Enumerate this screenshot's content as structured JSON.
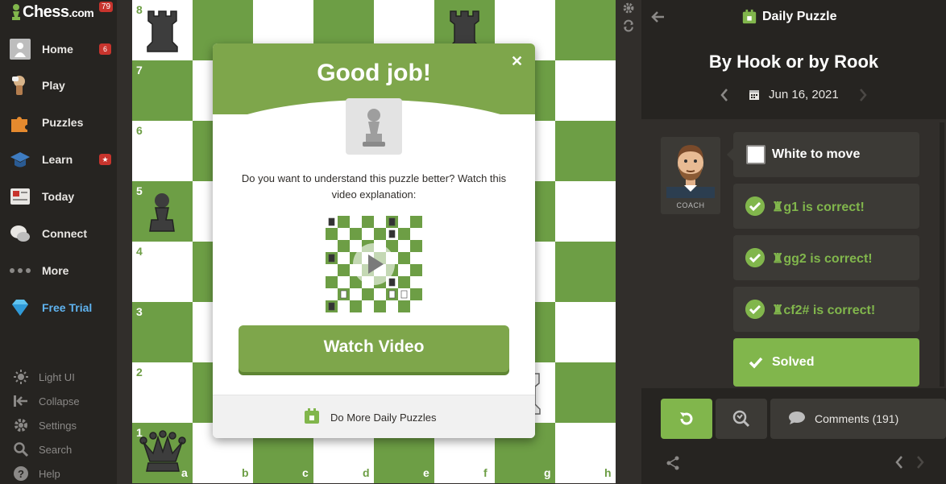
{
  "brand": {
    "logo_text": "Chess",
    "logo_suffix": ".com",
    "notif_count": "79"
  },
  "sidebar": {
    "items": [
      {
        "label": "Home",
        "badge": "6",
        "icon": "home-avatar-icon"
      },
      {
        "label": "Play",
        "badge": "",
        "icon": "play-hand-icon"
      },
      {
        "label": "Puzzles",
        "badge": "",
        "icon": "puzzle-piece-icon"
      },
      {
        "label": "Learn",
        "badge": "★",
        "icon": "graduation-cap-icon"
      },
      {
        "label": "Today",
        "badge": "",
        "icon": "newspaper-icon"
      },
      {
        "label": "Connect",
        "badge": "",
        "icon": "chat-bubbles-icon"
      },
      {
        "label": "More",
        "badge": "",
        "icon": "more-dots-icon"
      },
      {
        "label": "Free Trial",
        "badge": "",
        "icon": "diamond-icon"
      }
    ],
    "bottom": [
      {
        "label": "Light UI",
        "icon": "sun-icon"
      },
      {
        "label": "Collapse",
        "icon": "collapse-icon"
      },
      {
        "label": "Settings",
        "icon": "gear-icon"
      },
      {
        "label": "Search",
        "icon": "search-icon"
      },
      {
        "label": "Help",
        "icon": "help-icon"
      }
    ]
  },
  "board": {
    "ranks": [
      "8",
      "7",
      "6",
      "5",
      "4",
      "3",
      "2",
      "1"
    ],
    "files": [
      "a",
      "b",
      "c",
      "d",
      "e",
      "f",
      "g",
      "h"
    ]
  },
  "modal": {
    "title": "Good job!",
    "close": "✕",
    "text": "Do you want to understand this puzzle better? Watch this video explanation:",
    "button": "Watch Video",
    "footer": "Do More Daily Puzzles"
  },
  "panel": {
    "header": "Daily Puzzle",
    "title": "By Hook or by Rook",
    "date": "Jun 16, 2021",
    "coach_label": "COACH",
    "messages": [
      {
        "text": "White to move",
        "kind": "first"
      },
      {
        "text": "♜g1 is correct!",
        "kind": "correct"
      },
      {
        "text": "♜gg2 is correct!",
        "kind": "correct"
      },
      {
        "text": "♜cf2# is correct!",
        "kind": "correct"
      },
      {
        "text": "Solved",
        "kind": "solved"
      }
    ],
    "comments": "Comments (191)"
  },
  "colors": {
    "green": "#81b64c",
    "dark_square": "#6d9e45",
    "light_square": "#ffffff",
    "bg": "#312e2b"
  }
}
